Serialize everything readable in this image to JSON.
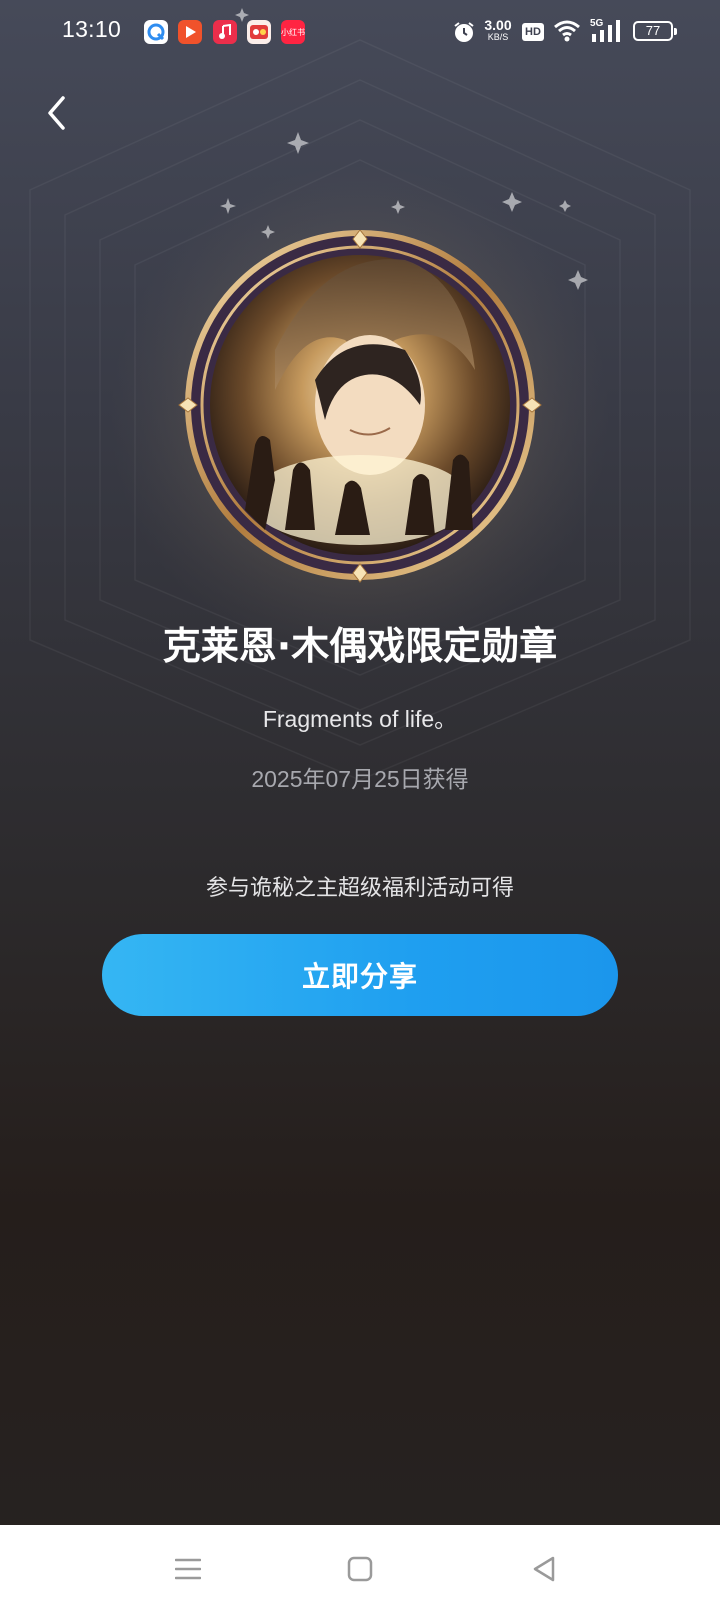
{
  "status_bar": {
    "time": "13:10",
    "net_speed_value": "3.00",
    "net_speed_unit": "KB/S",
    "hd_label": "HD",
    "signal_label": "5G",
    "battery": "77",
    "app_icons": [
      "browser-app-icon",
      "video-app-icon",
      "music-app-icon",
      "game-app-icon",
      "xiaohongshu-app-icon"
    ],
    "small_app_label": "小红书"
  },
  "header": {
    "back_icon": "chevron-left-icon"
  },
  "medal": {
    "title": "克莱恩·木偶戏限定勋章",
    "subtitle": "Fragments of life。",
    "date": "2025年07月25日获得",
    "condition": "参与诡秘之主超级福利活动可得",
    "share_label": "立即分享"
  },
  "nav_bar": {
    "menu_icon": "menu-icon",
    "home_icon": "home-square-icon",
    "back_icon": "back-triangle-icon"
  },
  "colors": {
    "accent": "#1f9ff0",
    "gold": "#c89a58"
  }
}
